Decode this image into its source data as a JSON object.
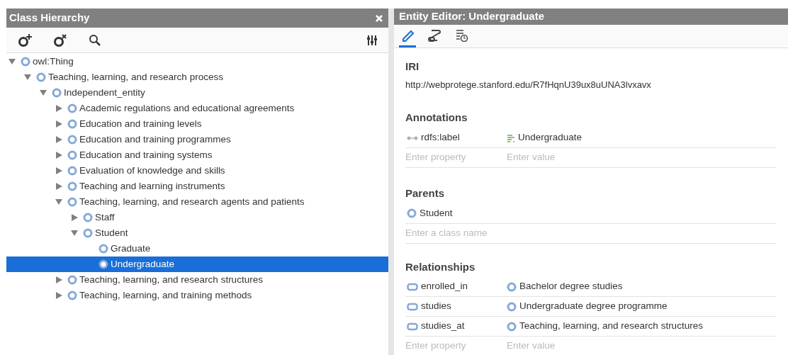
{
  "hierarchy": {
    "title": "Class Hierarchy",
    "tree": [
      {
        "label": "owl:Thing",
        "expanded": true,
        "selected": false,
        "children": [
          {
            "label": "Teaching, learning, and research process",
            "expanded": true,
            "selected": false,
            "children": [
              {
                "label": "Independent_entity",
                "expanded": true,
                "selected": false,
                "children": [
                  {
                    "label": "Academic regulations and educational agreements",
                    "expanded": false,
                    "selected": false
                  },
                  {
                    "label": "Education and training levels",
                    "expanded": false,
                    "selected": false
                  },
                  {
                    "label": "Education and training programmes",
                    "expanded": false,
                    "selected": false
                  },
                  {
                    "label": "Education and training systems",
                    "expanded": false,
                    "selected": false
                  },
                  {
                    "label": "Evaluation of knowledge and skills",
                    "expanded": false,
                    "selected": false
                  },
                  {
                    "label": "Teaching and learning instruments",
                    "expanded": false,
                    "selected": false
                  },
                  {
                    "label": "Teaching, learning, and research agents and patients",
                    "expanded": true,
                    "selected": false,
                    "children": [
                      {
                        "label": "Staff",
                        "expanded": false,
                        "selected": false
                      },
                      {
                        "label": "Student",
                        "expanded": true,
                        "selected": false,
                        "children": [
                          {
                            "label": "Graduate",
                            "selected": false
                          },
                          {
                            "label": "Undergraduate",
                            "selected": true
                          }
                        ]
                      }
                    ]
                  },
                  {
                    "label": "Teaching, learning, and research structures",
                    "expanded": false,
                    "selected": false
                  },
                  {
                    "label": "Teaching, learning, and training methods",
                    "expanded": false,
                    "selected": false
                  }
                ]
              }
            ]
          }
        ]
      }
    ]
  },
  "editor": {
    "title": "Entity Editor: Undergraduate",
    "tabs": [
      {
        "kind": "edit",
        "selected": true
      },
      {
        "kind": "graph",
        "selected": false
      },
      {
        "kind": "history",
        "selected": false
      }
    ],
    "iri": {
      "heading": "IRI",
      "value": "http://webprotege.stanford.edu/R7fHqnU39ux8uUNA3lvxavx"
    },
    "annotations": {
      "heading": "Annotations",
      "rows": [
        {
          "property": "rdfs:label",
          "value": "Undergraduate"
        }
      ],
      "property_placeholder": "Enter property",
      "value_placeholder": "Enter value"
    },
    "parents": {
      "heading": "Parents",
      "items": [
        "Student"
      ],
      "placeholder": "Enter a class name"
    },
    "relationships": {
      "heading": "Relationships",
      "rows": [
        {
          "property": "enrolled_in",
          "value": "Bachelor degree studies"
        },
        {
          "property": "studies",
          "value": "Undergraduate degree programme"
        },
        {
          "property": "studies_at",
          "value": "Teaching, learning, and research structures"
        }
      ],
      "property_placeholder": "Enter property",
      "value_placeholder": "Enter value"
    }
  }
}
